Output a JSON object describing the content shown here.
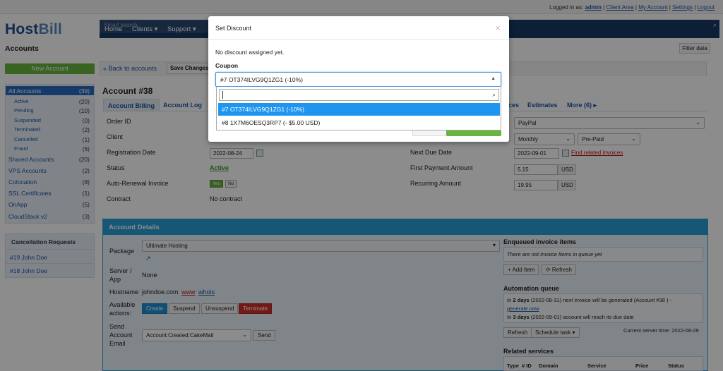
{
  "topbar": {
    "logged_in_as": "Logged in as:",
    "user": "admin",
    "links": [
      "Client Area",
      "My Account",
      "Settings",
      "Logout"
    ]
  },
  "logo": {
    "host": "Host",
    "bill": "Bill"
  },
  "nav": {
    "items": [
      "Home",
      "Clients ▾",
      "Support ▾"
    ],
    "search_placeholder": "Smart search"
  },
  "sidebar": {
    "title": "Accounts",
    "new_account": "New Account",
    "items": [
      {
        "label": "All Accounts",
        "count": "(39)"
      },
      {
        "label": "Active",
        "count": "(20)"
      },
      {
        "label": "Pending",
        "count": "(10)"
      },
      {
        "label": "Suspended",
        "count": "(0)"
      },
      {
        "label": "Terminated",
        "count": "(2)"
      },
      {
        "label": "Cancelled",
        "count": "(1)"
      },
      {
        "label": "Fraud",
        "count": "(6)"
      },
      {
        "label": "Shared Accounts",
        "count": "(20)"
      },
      {
        "label": "VPS Accounts",
        "count": "(2)"
      },
      {
        "label": "Colocation",
        "count": "(8)"
      },
      {
        "label": "SSL Certificates",
        "count": "(1)"
      },
      {
        "label": "OnApp",
        "count": "(5)"
      },
      {
        "label": "CloudStack v2",
        "count": "(3)"
      }
    ],
    "cancellation": {
      "title": "Cancellation Requests",
      "items": [
        "#19 John Doe",
        "#18 John Doe"
      ]
    }
  },
  "filter_button": "Filter data",
  "toolbar": {
    "back": "« Back to accounts",
    "save": "Save Changes"
  },
  "account": {
    "title": "Account #38",
    "tabs": [
      "Account Billing",
      "Account Log"
    ],
    "right_tabs": [
      "ces",
      "Estimates",
      "More (6) ▸"
    ],
    "fields": {
      "order_id": "Order ID",
      "client": "Client",
      "registration_date": "Registration Date",
      "registration_value": "2022-08-24",
      "status": "Status",
      "status_value": "Active",
      "auto_renewal": "Auto-Renewal Invoice",
      "yes": "Yes",
      "no": "No",
      "contract": "Contract",
      "contract_value": "No contract"
    },
    "right": {
      "gateway": "PayPal",
      "cycle": "Monthly",
      "type": "Pre-Paid",
      "next_due": "Next Due Date",
      "next_due_value": "2022-09-01",
      "find_invoices": "Find related invoices",
      "first_payment": "First Payment Amount",
      "first_payment_value": "5.15",
      "recurring": "Recurring Amount",
      "recurring_value": "19.95",
      "currency": "USD"
    }
  },
  "details": {
    "title": "Account Details",
    "package_label": "Package",
    "package_value": "Ultimate Hosting",
    "server_label": "Server / App",
    "server_value": "None",
    "hostname_label": "Hostname",
    "hostname_value": "johndoe.com",
    "www": "www",
    "whois": "whois",
    "actions_label": "Available actions:",
    "actions": [
      "Create",
      "Suspend",
      "Unsuspend",
      "Terminate"
    ],
    "send_label": "Send Account Email",
    "send_select": "Account:Created:CakeMail",
    "send_btn": "Send",
    "enqueued_title": "Enqueued invoice items",
    "enqueued_empty": "There are not Invoice Items in queue yet",
    "add_item": "+ Add Item",
    "refresh": "⟳ Refresh",
    "automation_title": "Automation queue",
    "auto_line1_pre": "In",
    "auto_line1_days": "2 days",
    "auto_line1_rest": "(2022-08-31) next invoice will be generated (Account #38 ) -",
    "auto_generate": "generate now",
    "auto_line2_pre": "In",
    "auto_line2_days": "3 days",
    "auto_line2_rest": "(2022-09-01) account will reach its due date",
    "refresh_btn": "Refresh",
    "schedule_btn": "Schedule task ▾",
    "server_time": "Current server time: 2022-08-29",
    "related_title": "Related services",
    "related_cols": [
      "Type",
      "# ID",
      "Domain",
      "Service",
      "Price",
      "Status"
    ]
  },
  "modal": {
    "title": "Set Discount",
    "close": "×",
    "text": "No discount assigned yet.",
    "coupon_label": "Coupon",
    "selected": "#7 OT374ILVG9Q1ZG1 (-10%)",
    "options": [
      "#7 OT374ILVG9Q1ZG1 (-10%)",
      "#8 1X7M6OESQ3RP7 (- $5.00 USD)"
    ]
  }
}
